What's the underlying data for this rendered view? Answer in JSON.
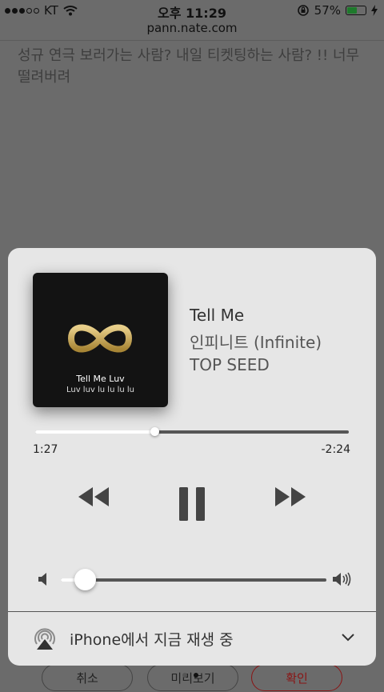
{
  "status_bar": {
    "carrier": "KT",
    "time": "오후 11:29",
    "battery_percent": "57%",
    "battery_level": 0.57
  },
  "browser": {
    "url": "pann.nate.com"
  },
  "page": {
    "text": "성규 연극 보러가는 사람? 내일 티켓팅하는 사람? !! 너무 떨려버려",
    "buttons": [
      "취소",
      "미리보기",
      "확인"
    ]
  },
  "now_playing": {
    "artwork": {
      "title": "Tell Me Luv",
      "subtitle": "Luv luv lu lu lu lu"
    },
    "track_title": "Tell Me",
    "artist": "인피니트 (Infinite)",
    "album": "TOP SEED",
    "elapsed": "1:27",
    "remaining": "-2:24",
    "progress_fraction": 0.38,
    "volume_fraction": 0.09,
    "output_label": "iPhone에서 지금 재생 중"
  },
  "colors": {
    "panel_bg": "#e6e6e6",
    "logo_gold": "#c8a85a",
    "confirm_red": "#8a1414"
  }
}
